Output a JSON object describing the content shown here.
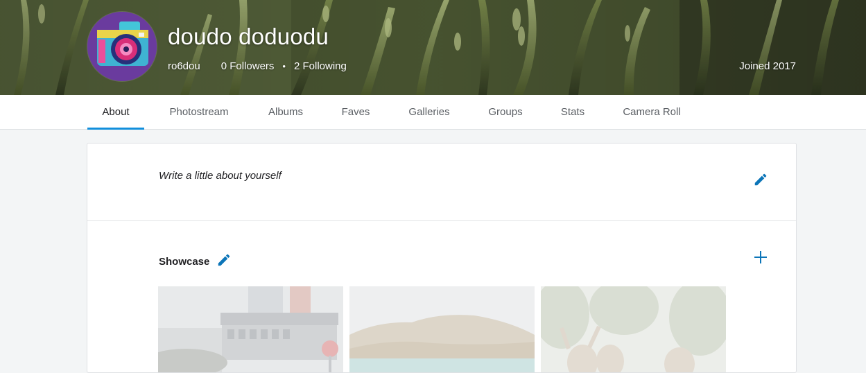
{
  "profile": {
    "display_name": "doudo doduodu",
    "username": "ro6dou",
    "followers": "0 Followers",
    "separator": "•",
    "following": "2 Following",
    "joined": "Joined 2017",
    "avatar_icon": "camera-icon"
  },
  "tabs": [
    {
      "label": "About",
      "active": true
    },
    {
      "label": "Photostream"
    },
    {
      "label": "Albums"
    },
    {
      "label": "Faves"
    },
    {
      "label": "Galleries"
    },
    {
      "label": "Groups"
    },
    {
      "label": "Stats"
    },
    {
      "label": "Camera Roll"
    }
  ],
  "about": {
    "placeholder": "Write a little about yourself",
    "edit_icon": "pencil-icon"
  },
  "showcase": {
    "title": "Showcase",
    "edit_icon": "pencil-icon",
    "add_icon": "plus-icon",
    "photos": [
      {
        "name": "showcase-photo-city-train"
      },
      {
        "name": "showcase-photo-coastal-cliff"
      },
      {
        "name": "showcase-photo-people-trees"
      }
    ]
  },
  "colors": {
    "accent": "#128fdc",
    "icon_blue": "#0c75b8",
    "page_bg": "#f3f5f6"
  }
}
